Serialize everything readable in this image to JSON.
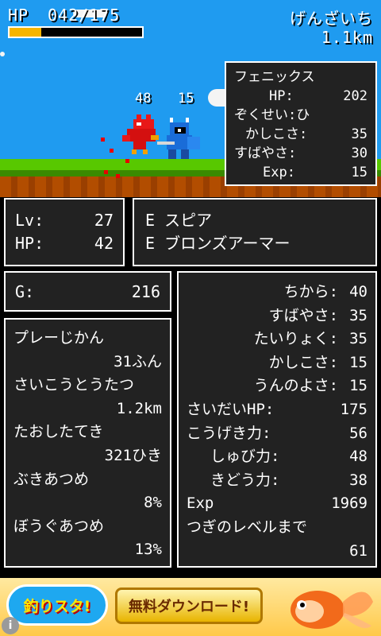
{
  "hud": {
    "hp_label": "HP",
    "hp_text": "042/175",
    "hp_fraction": 0.24,
    "location_name": "げんざいち",
    "distance": "1.1km"
  },
  "battle": {
    "damage_left": "48",
    "damage_right": "15"
  },
  "enemy": {
    "name": "フェニックス",
    "hp_label": "HP:",
    "hp_value": "202",
    "element_label": "ぞくせい:",
    "element_value": "ひ",
    "wisdom_label": "かしこさ:",
    "wisdom_value": "35",
    "speed_label": "すばやさ:",
    "speed_value": "30",
    "exp_label": "Exp:",
    "exp_value": "15"
  },
  "player": {
    "lv_label": "Lv:",
    "lv_value": "27",
    "hp_label": "HP:",
    "hp_value": "42"
  },
  "equipment": {
    "weapon": "E スピア",
    "armor": "E ブロンズアーマー"
  },
  "gold": {
    "label": "G:",
    "value": "216"
  },
  "records": [
    {
      "label": "プレーじかん",
      "value": "31ふん"
    },
    {
      "label": "さいこうとうたつ",
      "value": "1.2km"
    },
    {
      "label": "たおしたてき",
      "value": "321ひき"
    },
    {
      "label": "ぶきあつめ",
      "value": "8%"
    },
    {
      "label": "ぼうぐあつめ",
      "value": "13%"
    }
  ],
  "stats": [
    {
      "label": "ちから:",
      "value": "40"
    },
    {
      "label": "すばやさ:",
      "value": "35"
    },
    {
      "label": "たいりょく:",
      "value": "35"
    },
    {
      "label": "かしこさ:",
      "value": "15"
    },
    {
      "label": "うんのよさ:",
      "value": "15"
    },
    {
      "label": "さいだいHP:",
      "value": "175"
    },
    {
      "label": "こうげき力:",
      "value": "56"
    },
    {
      "label": "しゅび力:",
      "value": "48"
    },
    {
      "label": "きどう力:",
      "value": "38"
    },
    {
      "label": "Exp",
      "value": "1969"
    }
  ],
  "next_level": {
    "label": "つぎのレベルまで",
    "value": "61"
  },
  "ad": {
    "logo_text": "釣りスタ!",
    "button_label": "無料ダウンロード!",
    "info_icon": "info-icon"
  },
  "colors": {
    "sky": "#1f9bf0",
    "grass": "#58c800",
    "hp_fill": "#f7b500",
    "panel": "#222222",
    "ad_button": "#e8b400"
  }
}
